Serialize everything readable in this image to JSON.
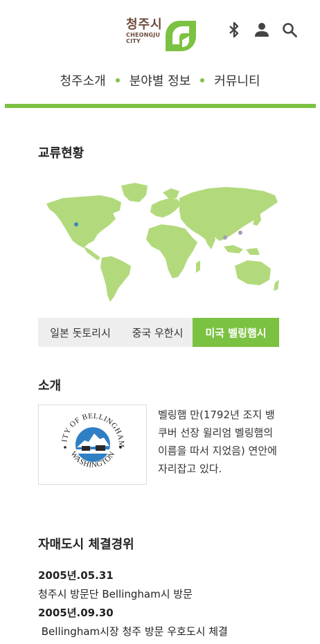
{
  "header": {
    "logo_kor": "청주시",
    "logo_eng_1": "CHEONGJU",
    "logo_eng_2": "CITY"
  },
  "icons": [
    "bluetooth-icon",
    "user-icon",
    "search-icon"
  ],
  "nav": {
    "items": [
      "청주소개",
      "분야별 정보",
      "커뮤니티"
    ]
  },
  "colors": {
    "accent": "#7cc242",
    "map_land": "#b2da7c",
    "marker": "#a49cb8",
    "marker_active": "#3b86b8",
    "logo_brown": "#6b4a3a",
    "seal_blue": "#2e7fc4"
  },
  "exchange": {
    "title": "교류현황",
    "tabs": [
      "일본 돗토리시",
      "중국 우한시",
      "미국 벨링햄시"
    ],
    "active_tab": 2
  },
  "intro": {
    "title": "소개",
    "text": "벨링햄 만(1792년 조지 뱅쿠버 선장 윌리엄 벨링햄의 이름을 따서 지었음) 연안에 자리잡고 있다.",
    "seal_top": "CITY OF BELLINGHAM",
    "seal_bottom": "WASHINGTON"
  },
  "history": {
    "title": "자매도시 체결경위",
    "entries": [
      {
        "date": "2005년.05.31",
        "desc": "청주시 방문단 Bellingham시 방문"
      },
      {
        "date": "2005년.09.30",
        "desc": " Bellingham시장 청주 방문 우호도시 체결"
      }
    ]
  }
}
